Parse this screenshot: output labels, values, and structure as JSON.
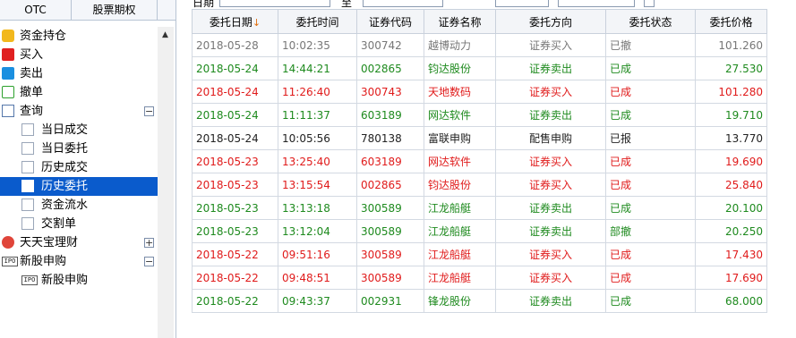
{
  "tabs": [
    "OTC",
    "股票期权"
  ],
  "toolbar": {
    "date_label": "日期",
    "to_label": "至"
  },
  "tree": [
    {
      "label": "资金持仓",
      "icon": "money-bag-icon"
    },
    {
      "label": "买入",
      "icon": "buy-icon"
    },
    {
      "label": "卖出",
      "icon": "sell-icon"
    },
    {
      "label": "撤单",
      "icon": "cancel-icon"
    },
    {
      "label": "查询",
      "icon": "query-icon",
      "expander": "−"
    },
    {
      "label": "当日成交",
      "icon": "query-sub-icon"
    },
    {
      "label": "当日委托",
      "icon": "query-sub-icon"
    },
    {
      "label": "历史成交",
      "icon": "query-sub-icon"
    },
    {
      "label": "历史委托",
      "icon": "query-sub-icon",
      "selected": true
    },
    {
      "label": "资金流水",
      "icon": "query-sub-icon"
    },
    {
      "label": "交割单",
      "icon": "query-sub-icon"
    },
    {
      "label": "天天宝理财",
      "icon": "tiantianbao-icon",
      "expander": "+"
    },
    {
      "label": "新股申购",
      "icon": "ipo-icon",
      "icon_text": "IPO",
      "expander": "−"
    },
    {
      "label": "新股申购",
      "icon": "ipo-icon",
      "icon_text": "IPO"
    }
  ],
  "table": {
    "headers": [
      "委托日期",
      "委托时间",
      "证券代码",
      "证券名称",
      "委托方向",
      "委托状态",
      "委托价格"
    ],
    "sort_indicator": "↓",
    "rows": [
      {
        "style": "grey",
        "cells": [
          "2018-05-28",
          "10:02:35",
          "300742",
          "越博动力",
          "证券买入",
          "已撤",
          "101.260"
        ]
      },
      {
        "style": "green",
        "cells": [
          "2018-05-24",
          "14:44:21",
          "002865",
          "钧达股份",
          "证券卖出",
          "已成",
          "27.530"
        ]
      },
      {
        "style": "red",
        "cells": [
          "2018-05-24",
          "11:26:40",
          "300743",
          "天地数码",
          "证券买入",
          "已成",
          "101.280"
        ]
      },
      {
        "style": "green",
        "cells": [
          "2018-05-24",
          "11:11:37",
          "603189",
          "网达软件",
          "证券卖出",
          "已成",
          "19.710"
        ]
      },
      {
        "style": "black",
        "cells": [
          "2018-05-24",
          "10:05:56",
          "780138",
          "富联申购",
          "配售申购",
          "已报",
          "13.770"
        ]
      },
      {
        "style": "red",
        "cells": [
          "2018-05-23",
          "13:25:40",
          "603189",
          "网达软件",
          "证券买入",
          "已成",
          "19.690"
        ]
      },
      {
        "style": "red",
        "cells": [
          "2018-05-23",
          "13:15:54",
          "002865",
          "钧达股份",
          "证券买入",
          "已成",
          "25.840"
        ]
      },
      {
        "style": "green",
        "cells": [
          "2018-05-23",
          "13:13:18",
          "300589",
          "江龙船艇",
          "证券卖出",
          "已成",
          "20.100"
        ]
      },
      {
        "style": "green",
        "cells": [
          "2018-05-23",
          "13:12:04",
          "300589",
          "江龙船艇",
          "证券卖出",
          "部撤",
          "20.250"
        ]
      },
      {
        "style": "red",
        "cells": [
          "2018-05-22",
          "09:51:16",
          "300589",
          "江龙船艇",
          "证券买入",
          "已成",
          "17.430"
        ]
      },
      {
        "style": "red",
        "cells": [
          "2018-05-22",
          "09:48:51",
          "300589",
          "江龙船艇",
          "证券买入",
          "已成",
          "17.690"
        ]
      },
      {
        "style": "green",
        "cells": [
          "2018-05-22",
          "09:43:37",
          "002931",
          "锋龙股份",
          "证券卖出",
          "已成",
          "68.000"
        ]
      }
    ]
  },
  "colors": {
    "selected": "#0a5bcc",
    "buy": "#e01b1b",
    "sell": "#1e8a1e",
    "cancelled": "#777777"
  }
}
